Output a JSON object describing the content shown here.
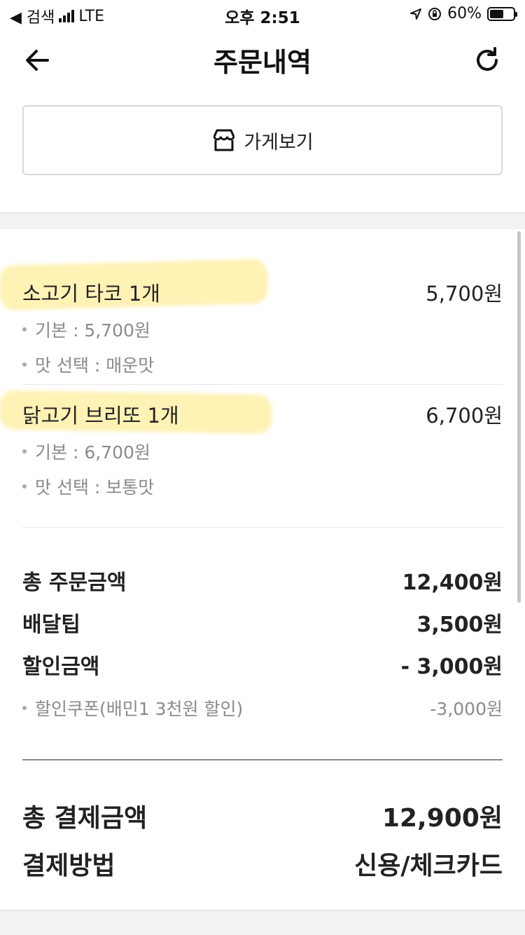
{
  "status_bar": {
    "back_app": "◀ 검색",
    "network": "LTE",
    "time": "오후 2:51",
    "battery_percent": "60%",
    "battery_level": 0.6
  },
  "header": {
    "title": "주문내역"
  },
  "store_button": {
    "label": "가게보기"
  },
  "items": [
    {
      "name": "소고기 타코 1개",
      "price": "5,700원",
      "options": [
        "기본 : 5,700원",
        "맛 선택 : 매운맛"
      ]
    },
    {
      "name": "닭고기 브리또 1개",
      "price": "6,700원",
      "options": [
        "기본 : 6,700원",
        "맛 선택 : 보통맛"
      ]
    }
  ],
  "summary": {
    "order_total_label": "총 주문금액",
    "order_total_value": "12,400원",
    "delivery_tip_label": "배달팁",
    "delivery_tip_value": "3,500원",
    "discount_label": "할인금액",
    "discount_value": "- 3,000원",
    "coupon_label": "할인쿠폰(배민1 3천원 할인)",
    "coupon_value": "-3,000원"
  },
  "payment": {
    "total_label": "총 결제금액",
    "total_value": "12,900원",
    "method_label": "결제방법",
    "method_value": "신용/체크카드"
  },
  "colors": {
    "highlight": "#ffe25a",
    "text": "#222222",
    "muted": "#8a8a8a"
  }
}
